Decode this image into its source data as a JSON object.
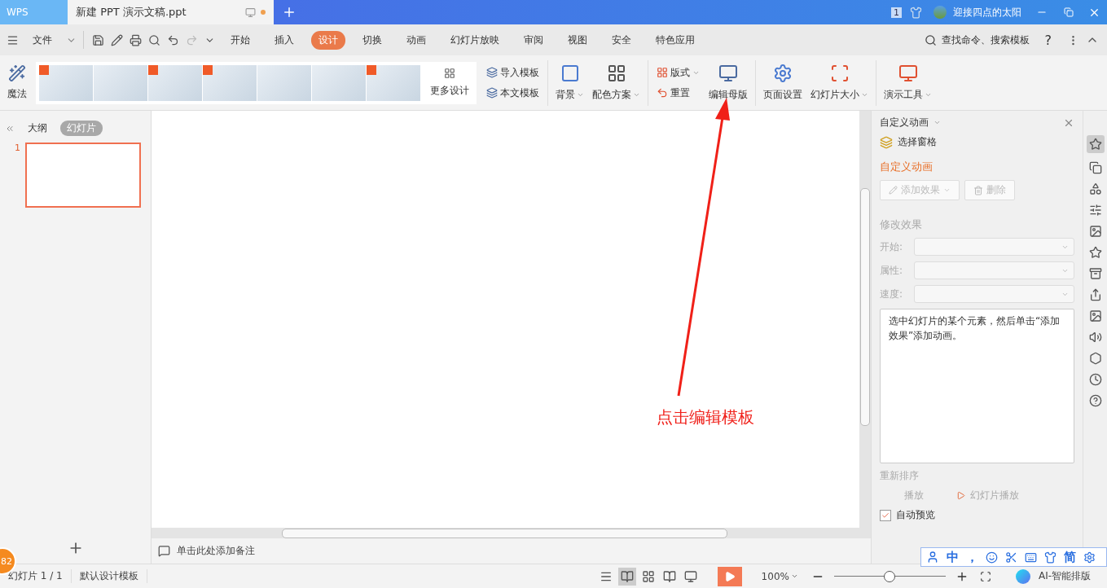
{
  "title_bar": {
    "app_tab": "WPS",
    "doc_tab": {
      "title": "新建 PPT 演示文稿.ppt",
      "selected": true,
      "unsaved": true
    },
    "window_badge": "1",
    "user_name": "迎接四点的太阳"
  },
  "menu_bar": {
    "file": "文件",
    "tabs": [
      {
        "label": "开始",
        "selected": false
      },
      {
        "label": "插入",
        "selected": false
      },
      {
        "label": "设计",
        "selected": true
      },
      {
        "label": "切换",
        "selected": false
      },
      {
        "label": "动画",
        "selected": false
      },
      {
        "label": "幻灯片放映",
        "selected": false
      },
      {
        "label": "审阅",
        "selected": false
      },
      {
        "label": "视图",
        "selected": false
      },
      {
        "label": "安全",
        "selected": false
      },
      {
        "label": "特色应用",
        "selected": false
      }
    ],
    "search": "查找命令、搜索模板",
    "help": "?"
  },
  "ribbon": {
    "magic": "魔法",
    "templates": [
      {
        "hot": true
      },
      {
        "hot": false
      },
      {
        "hot": true
      },
      {
        "hot": true
      },
      {
        "hot": false
      },
      {
        "hot": false
      },
      {
        "hot": true
      }
    ],
    "more_designs": "更多设计",
    "import_template": "导入模板",
    "this_template": "本文模板",
    "buttons": [
      {
        "label": "背景",
        "kind": "background",
        "dropdown": true
      },
      {
        "label": "配色方案",
        "kind": "colors",
        "dropdown": true
      }
    ],
    "layout": {
      "label": "版式",
      "dropdown": true
    },
    "reset": "重置",
    "buttons2": [
      {
        "label": "编辑母版",
        "kind": "master",
        "dropdown": false
      },
      {
        "label": "页面设置",
        "kind": "page",
        "dropdown": false
      },
      {
        "label": "幻灯片大小",
        "kind": "size",
        "dropdown": true
      },
      {
        "label": "演示工具",
        "kind": "tools",
        "dropdown": true
      }
    ]
  },
  "left_panel": {
    "tabs": [
      {
        "label": "大纲",
        "selected": false
      },
      {
        "label": "幻灯片",
        "selected": true
      }
    ],
    "slides": [
      {
        "number": "1",
        "selected": true
      }
    ]
  },
  "notes": {
    "placeholder": "单击此处添加备注"
  },
  "annotation": "点击编辑模板",
  "animation_pane": {
    "title": "自定义动画",
    "select_pane": "选择窗格",
    "section": "自定义动画",
    "add_effect": {
      "label": "添加效果",
      "disabled": true
    },
    "delete": {
      "label": "删除",
      "disabled": true
    },
    "modify_heading": "修改效果",
    "fields": [
      {
        "label": "开始:"
      },
      {
        "label": "属性:"
      },
      {
        "label": "速度:"
      }
    ],
    "hint": "选中幻灯片的某个元素，然后单击“添加效果”添加动画。",
    "reorder": "重新排序",
    "play": "播放",
    "slideshow": "幻灯片播放",
    "auto_preview": {
      "label": "自动预览",
      "checked": true
    }
  },
  "ime_bar": [
    "中",
    "，",
    "简"
  ],
  "status_bar": {
    "badge": "82",
    "slide_info": "幻灯片 1 / 1",
    "template": "默认设计模板",
    "zoom": "100%",
    "zoom_level": {
      "level": 0.5
    },
    "ai": "AI-智能排版"
  }
}
